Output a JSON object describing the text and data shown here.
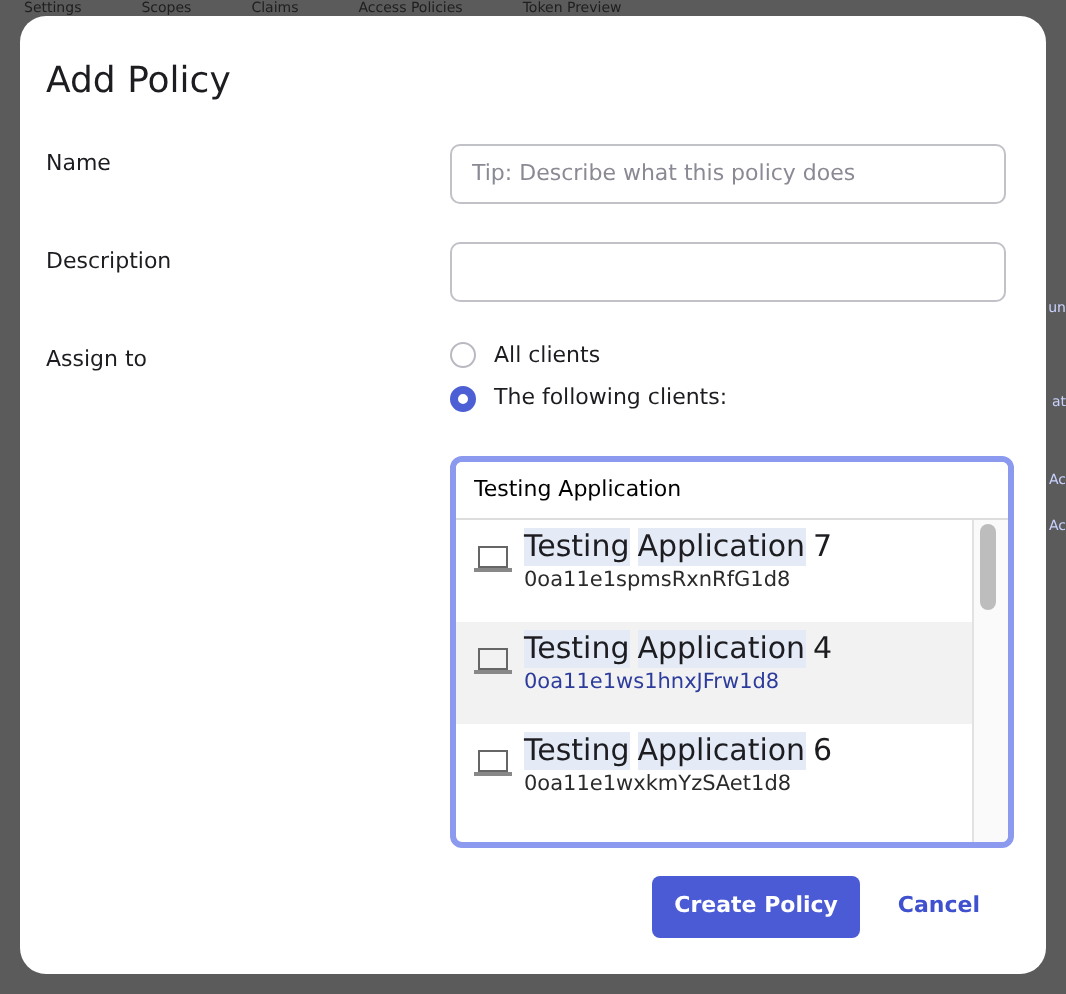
{
  "background_tabs": [
    "Settings",
    "Scopes",
    "Claims",
    "Access Policies",
    "Token Preview"
  ],
  "background_fragments": [
    "un",
    "at",
    "Ac",
    "Ac"
  ],
  "dialog": {
    "title": "Add Policy",
    "fields": [
      {
        "label": "Name",
        "placeholder": "Tip: Describe what this policy does"
      },
      {
        "label": "Description"
      }
    ],
    "assign_to": {
      "label": "Assign to",
      "options": [
        {
          "label": "All clients",
          "selected": false
        },
        {
          "label": "The following clients:",
          "selected": true
        }
      ]
    },
    "client_search": {
      "value": "Testing Application",
      "results": [
        {
          "name_parts": [
            {
              "text": "Testing",
              "match": true
            },
            {
              "text": "Application",
              "match": true
            },
            {
              "text": "7",
              "match": false
            }
          ],
          "id": "0oa11e1spmsRxnRfG1d8",
          "highlighted": false
        },
        {
          "name_parts": [
            {
              "text": "Testing",
              "match": true
            },
            {
              "text": "Application",
              "match": true
            },
            {
              "text": "4",
              "match": false
            }
          ],
          "id": "0oa11e1ws1hnxJFrw1d8",
          "highlighted": true
        },
        {
          "name_parts": [
            {
              "text": "Testing",
              "match": true
            },
            {
              "text": "Application",
              "match": true
            },
            {
              "text": "6",
              "match": false
            }
          ],
          "id": "0oa11e1wxkmYzSAet1d8",
          "highlighted": false
        }
      ]
    },
    "buttons": [
      {
        "label": "Create Policy",
        "kind": "primary"
      },
      {
        "label": "Cancel",
        "kind": "link"
      }
    ]
  }
}
